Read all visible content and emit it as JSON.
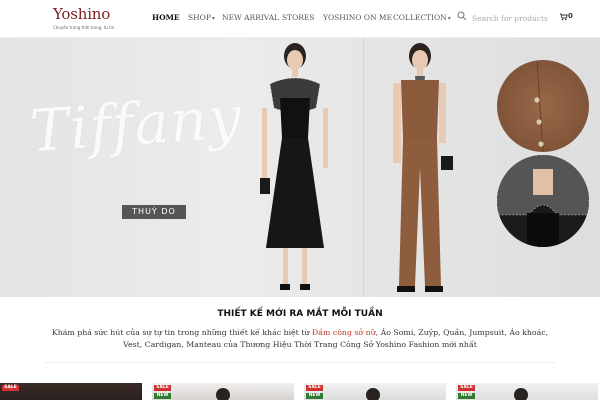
{
  "header": {
    "logo": {
      "word": "Yoshino",
      "tagline": "Chuyên trang thời trang, tự tin"
    },
    "nav": [
      {
        "label": "HOME",
        "active": true,
        "dropdown": false
      },
      {
        "label": "SHOP",
        "active": false,
        "dropdown": true
      },
      {
        "label": "NEW ARRIVAL",
        "active": false,
        "dropdown": false
      },
      {
        "label": "STORES",
        "active": false,
        "dropdown": false
      },
      {
        "label": "YOSHINO ON ME",
        "active": false,
        "dropdown": false
      },
      {
        "label": "COLLECTION",
        "active": false,
        "dropdown": true
      }
    ],
    "search": {
      "placeholder": "Search for products",
      "icon": "search-icon"
    },
    "cart": {
      "count": "0",
      "icon": "cart-icon"
    }
  },
  "hero": {
    "script_title": "Tiffany",
    "subtitle": "THUỲ DO"
  },
  "section": {
    "title": "THIẾT KẾ MỚI RA MẮT MỖI TUẦN",
    "desc_before": "Khám phá sức hút của sự tự tin trong những thiết kế khác biệt từ ",
    "desc_highlight": "Đầm công sở nữ",
    "desc_after": ", Áo Somi, Zuýp, Quần, Jumpsuit, Áo khoác, Vest, Cardigan, Manteau của Thương Hiệu Thời Trang Công Sở Yoshino Fashion mới nhất"
  },
  "products": [
    {
      "badges": [
        "SALE"
      ]
    },
    {
      "badges": [
        "SALE",
        "NEW"
      ]
    },
    {
      "badges": [
        "SALE",
        "NEW"
      ]
    },
    {
      "badges": [
        "SALE",
        "NEW"
      ]
    }
  ],
  "colors": {
    "brand_red": "#c62828",
    "badge_sale": "#d32f2f",
    "badge_new": "#2e7d32",
    "highlight": "#c0392b"
  }
}
